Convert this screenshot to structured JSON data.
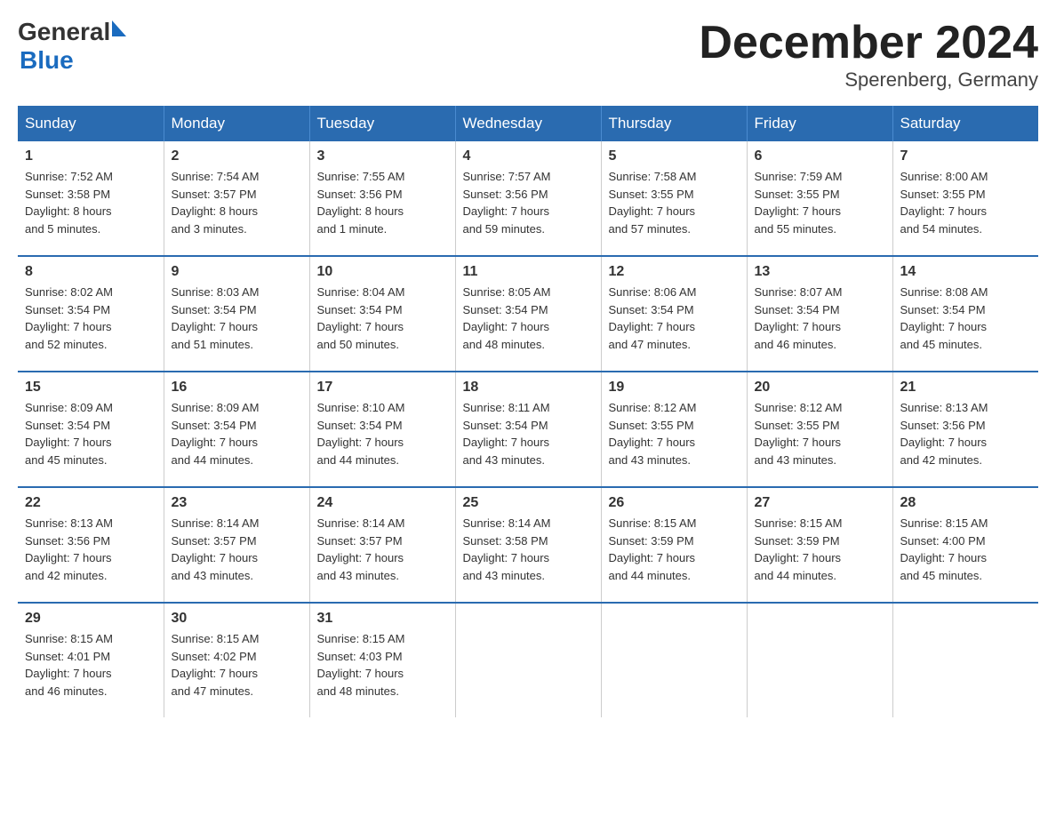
{
  "header": {
    "logo_general": "General",
    "logo_blue": "Blue",
    "month_title": "December 2024",
    "location": "Sperenberg, Germany"
  },
  "days_of_week": [
    "Sunday",
    "Monday",
    "Tuesday",
    "Wednesday",
    "Thursday",
    "Friday",
    "Saturday"
  ],
  "weeks": [
    [
      {
        "day": "1",
        "sunrise": "7:52 AM",
        "sunset": "3:58 PM",
        "daylight": "8 hours and 5 minutes."
      },
      {
        "day": "2",
        "sunrise": "7:54 AM",
        "sunset": "3:57 PM",
        "daylight": "8 hours and 3 minutes."
      },
      {
        "day": "3",
        "sunrise": "7:55 AM",
        "sunset": "3:56 PM",
        "daylight": "8 hours and 1 minute."
      },
      {
        "day": "4",
        "sunrise": "7:57 AM",
        "sunset": "3:56 PM",
        "daylight": "7 hours and 59 minutes."
      },
      {
        "day": "5",
        "sunrise": "7:58 AM",
        "sunset": "3:55 PM",
        "daylight": "7 hours and 57 minutes."
      },
      {
        "day": "6",
        "sunrise": "7:59 AM",
        "sunset": "3:55 PM",
        "daylight": "7 hours and 55 minutes."
      },
      {
        "day": "7",
        "sunrise": "8:00 AM",
        "sunset": "3:55 PM",
        "daylight": "7 hours and 54 minutes."
      }
    ],
    [
      {
        "day": "8",
        "sunrise": "8:02 AM",
        "sunset": "3:54 PM",
        "daylight": "7 hours and 52 minutes."
      },
      {
        "day": "9",
        "sunrise": "8:03 AM",
        "sunset": "3:54 PM",
        "daylight": "7 hours and 51 minutes."
      },
      {
        "day": "10",
        "sunrise": "8:04 AM",
        "sunset": "3:54 PM",
        "daylight": "7 hours and 50 minutes."
      },
      {
        "day": "11",
        "sunrise": "8:05 AM",
        "sunset": "3:54 PM",
        "daylight": "7 hours and 48 minutes."
      },
      {
        "day": "12",
        "sunrise": "8:06 AM",
        "sunset": "3:54 PM",
        "daylight": "7 hours and 47 minutes."
      },
      {
        "day": "13",
        "sunrise": "8:07 AM",
        "sunset": "3:54 PM",
        "daylight": "7 hours and 46 minutes."
      },
      {
        "day": "14",
        "sunrise": "8:08 AM",
        "sunset": "3:54 PM",
        "daylight": "7 hours and 45 minutes."
      }
    ],
    [
      {
        "day": "15",
        "sunrise": "8:09 AM",
        "sunset": "3:54 PM",
        "daylight": "7 hours and 45 minutes."
      },
      {
        "day": "16",
        "sunrise": "8:09 AM",
        "sunset": "3:54 PM",
        "daylight": "7 hours and 44 minutes."
      },
      {
        "day": "17",
        "sunrise": "8:10 AM",
        "sunset": "3:54 PM",
        "daylight": "7 hours and 44 minutes."
      },
      {
        "day": "18",
        "sunrise": "8:11 AM",
        "sunset": "3:54 PM",
        "daylight": "7 hours and 43 minutes."
      },
      {
        "day": "19",
        "sunrise": "8:12 AM",
        "sunset": "3:55 PM",
        "daylight": "7 hours and 43 minutes."
      },
      {
        "day": "20",
        "sunrise": "8:12 AM",
        "sunset": "3:55 PM",
        "daylight": "7 hours and 43 minutes."
      },
      {
        "day": "21",
        "sunrise": "8:13 AM",
        "sunset": "3:56 PM",
        "daylight": "7 hours and 42 minutes."
      }
    ],
    [
      {
        "day": "22",
        "sunrise": "8:13 AM",
        "sunset": "3:56 PM",
        "daylight": "7 hours and 42 minutes."
      },
      {
        "day": "23",
        "sunrise": "8:14 AM",
        "sunset": "3:57 PM",
        "daylight": "7 hours and 43 minutes."
      },
      {
        "day": "24",
        "sunrise": "8:14 AM",
        "sunset": "3:57 PM",
        "daylight": "7 hours and 43 minutes."
      },
      {
        "day": "25",
        "sunrise": "8:14 AM",
        "sunset": "3:58 PM",
        "daylight": "7 hours and 43 minutes."
      },
      {
        "day": "26",
        "sunrise": "8:15 AM",
        "sunset": "3:59 PM",
        "daylight": "7 hours and 44 minutes."
      },
      {
        "day": "27",
        "sunrise": "8:15 AM",
        "sunset": "3:59 PM",
        "daylight": "7 hours and 44 minutes."
      },
      {
        "day": "28",
        "sunrise": "8:15 AM",
        "sunset": "4:00 PM",
        "daylight": "7 hours and 45 minutes."
      }
    ],
    [
      {
        "day": "29",
        "sunrise": "8:15 AM",
        "sunset": "4:01 PM",
        "daylight": "7 hours and 46 minutes."
      },
      {
        "day": "30",
        "sunrise": "8:15 AM",
        "sunset": "4:02 PM",
        "daylight": "7 hours and 47 minutes."
      },
      {
        "day": "31",
        "sunrise": "8:15 AM",
        "sunset": "4:03 PM",
        "daylight": "7 hours and 48 minutes."
      },
      null,
      null,
      null,
      null
    ]
  ],
  "labels": {
    "sunrise": "Sunrise:",
    "sunset": "Sunset:",
    "daylight": "Daylight:"
  }
}
